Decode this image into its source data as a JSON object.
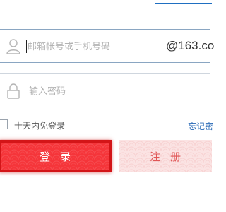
{
  "username": {
    "placeholder": "邮箱帐号或手机号码",
    "value": "",
    "suffix": "@163.co"
  },
  "password": {
    "placeholder": "输入密码",
    "value": ""
  },
  "remember": {
    "label": "十天内免登录",
    "checked": false
  },
  "forgot_label": "忘记密",
  "buttons": {
    "login": "登录",
    "register": "注册"
  },
  "colors": {
    "login_bg": "#f5353a",
    "register_bg": "#fbe3e3",
    "link": "#2a6ab7"
  },
  "icons": {
    "user": "user-icon",
    "lock": "lock-icon"
  }
}
